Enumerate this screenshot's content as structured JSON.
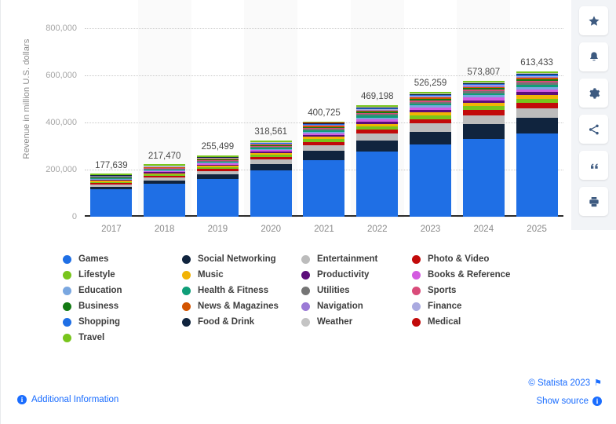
{
  "chart_data": {
    "type": "bar",
    "subtype": "stacked-bar",
    "title": "",
    "xlabel": "",
    "ylabel": "Revenue in million U.S. dollars",
    "categories": [
      "2017",
      "2018",
      "2019",
      "2020",
      "2021",
      "2022",
      "2023",
      "2024",
      "2025"
    ],
    "totals": [
      "177,639",
      "217,470",
      "255,499",
      "318,561",
      "400,725",
      "469,198",
      "526,259",
      "573,807",
      "613,433"
    ],
    "totals_numeric": [
      177639,
      217470,
      255499,
      318561,
      400725,
      469198,
      526259,
      573807,
      613433
    ],
    "ylim": [
      0,
      800000
    ],
    "yticks": [
      "0",
      "200,000",
      "400,000",
      "600,000",
      "800,000"
    ],
    "ytick_values": [
      0,
      200000,
      400000,
      600000,
      800000
    ],
    "grid": true,
    "legend_position": "bottom",
    "series": [
      {
        "name": "Games",
        "color": "#1f6fe5",
        "values": [
          117000,
          140000,
          167000,
          205000,
          250000,
          291000,
          330000,
          360000,
          385000
        ]
      },
      {
        "name": "Social Networking",
        "color": "#10243e",
        "values": [
          12000,
          16000,
          20000,
          28000,
          39000,
          49000,
          58000,
          67000,
          74000
        ]
      },
      {
        "name": "Entertainment",
        "color": "#bcbcbc",
        "values": [
          10000,
          12000,
          14000,
          19000,
          26000,
          32000,
          37000,
          41000,
          45000
        ]
      },
      {
        "name": "Photo & Video",
        "color": "#c20a0a",
        "values": [
          5000,
          7000,
          9000,
          12000,
          15000,
          18000,
          21000,
          23000,
          25000
        ]
      },
      {
        "name": "Lifestyle",
        "color": "#78c51c",
        "values": [
          4500,
          6000,
          7500,
          9500,
          12000,
          14500,
          16500,
          18000,
          19500
        ]
      },
      {
        "name": "Music",
        "color": "#f2b305",
        "values": [
          4000,
          5000,
          6000,
          7500,
          9500,
          11500,
          13000,
          14500,
          15500
        ]
      },
      {
        "name": "Productivity",
        "color": "#5c0d7a",
        "values": [
          3500,
          4500,
          5500,
          7000,
          9000,
          11000,
          12500,
          13500,
          14500
        ]
      },
      {
        "name": "Books & Reference",
        "color": "#d35ce0",
        "values": [
          3000,
          4000,
          5000,
          6000,
          7500,
          9000,
          10500,
          11500,
          12500
        ]
      },
      {
        "name": "Education",
        "color": "#7aa7e0",
        "values": [
          2800,
          3600,
          4400,
          5500,
          7000,
          8500,
          9800,
          10800,
          11500
        ]
      },
      {
        "name": "Health & Fitness",
        "color": "#0f9e78",
        "values": [
          2500,
          3200,
          4000,
          5000,
          6500,
          8000,
          9200,
          10200,
          11000
        ]
      },
      {
        "name": "Utilities",
        "color": "#757575",
        "values": [
          2200,
          2800,
          3400,
          4200,
          5500,
          6800,
          7800,
          8600,
          9300
        ]
      },
      {
        "name": "Sports",
        "color": "#d94b7a",
        "values": [
          2000,
          2500,
          3000,
          3800,
          4800,
          5900,
          6800,
          7500,
          8100
        ]
      },
      {
        "name": "Business",
        "color": "#137a13",
        "values": [
          1800,
          2200,
          2700,
          3400,
          4300,
          5300,
          6100,
          6700,
          7200
        ]
      },
      {
        "name": "News & Magazines",
        "color": "#d35400",
        "values": [
          1600,
          2000,
          2400,
          3000,
          3800,
          4700,
          5400,
          5900,
          6400
        ]
      },
      {
        "name": "Navigation",
        "color": "#9b7ad6",
        "values": [
          1400,
          1700,
          2100,
          2600,
          3300,
          4000,
          4600,
          5100,
          5500
        ]
      },
      {
        "name": "Finance",
        "color": "#aaaae0",
        "values": [
          1200,
          1500,
          1800,
          2300,
          2900,
          3500,
          4000,
          4400,
          4800
        ]
      },
      {
        "name": "Shopping",
        "color": "#1f6fe5",
        "values": [
          1000,
          1300,
          1600,
          2000,
          2500,
          3000,
          3500,
          3800,
          4100
        ]
      },
      {
        "name": "Food & Drink",
        "color": "#10243e",
        "values": [
          900,
          1100,
          1400,
          1700,
          2200,
          2700,
          3100,
          3400,
          3700
        ]
      },
      {
        "name": "Weather",
        "color": "#c4c4c4",
        "values": [
          800,
          1000,
          1200,
          1500,
          1900,
          2300,
          2700,
          3000,
          3200
        ]
      },
      {
        "name": "Medical",
        "color": "#c20a0a",
        "values": [
          700,
          900,
          1100,
          1400,
          1700,
          2100,
          2400,
          2700,
          2900
        ]
      },
      {
        "name": "Travel",
        "color": "#78c51c",
        "values": [
          600,
          800,
          1000,
          1200,
          1500,
          1900,
          2200,
          2400,
          2600
        ]
      }
    ]
  },
  "legend": {
    "columns": [
      [
        {
          "label": "Games",
          "color": "#1f6fe5"
        },
        {
          "label": "Lifestyle",
          "color": "#78c51c"
        },
        {
          "label": "Education",
          "color": "#7aa7e0"
        },
        {
          "label": "Business",
          "color": "#137a13"
        },
        {
          "label": "Shopping",
          "color": "#1f6fe5"
        },
        {
          "label": "Travel",
          "color": "#78c51c"
        }
      ],
      [
        {
          "label": "Social Networking",
          "color": "#10243e"
        },
        {
          "label": "Music",
          "color": "#f2b305"
        },
        {
          "label": "Health & Fitness",
          "color": "#0f9e78"
        },
        {
          "label": "News & Magazines",
          "color": "#d35400"
        },
        {
          "label": "Food & Drink",
          "color": "#10243e"
        }
      ],
      [
        {
          "label": "Entertainment",
          "color": "#bcbcbc"
        },
        {
          "label": "Productivity",
          "color": "#5c0d7a"
        },
        {
          "label": "Utilities",
          "color": "#757575"
        },
        {
          "label": "Navigation",
          "color": "#9b7ad6"
        },
        {
          "label": "Weather",
          "color": "#c4c4c4"
        }
      ],
      [
        {
          "label": "Photo & Video",
          "color": "#c20a0a"
        },
        {
          "label": "Books & Reference",
          "color": "#d35ce0"
        },
        {
          "label": "Sports",
          "color": "#d94b7a"
        },
        {
          "label": "Finance",
          "color": "#aaaae0"
        },
        {
          "label": "Medical",
          "color": "#c20a0a"
        }
      ]
    ]
  },
  "toolbar": {
    "buttons": [
      {
        "icon": "star-icon",
        "title": "Favorite"
      },
      {
        "icon": "bell-icon",
        "title": "Notify"
      },
      {
        "icon": "gear-icon",
        "title": "Settings"
      },
      {
        "icon": "share-icon",
        "title": "Share"
      },
      {
        "icon": "quote-icon",
        "title": "Cite"
      },
      {
        "icon": "print-icon",
        "title": "Print"
      }
    ]
  },
  "footer": {
    "additional_information": "Additional Information",
    "copyright": "© Statista 2023",
    "show_source": "Show source",
    "info_glyph": "i"
  },
  "colors": {
    "accent": "#1a6dff",
    "axis_text": "#8a8a8a",
    "band": "#fafafa"
  }
}
